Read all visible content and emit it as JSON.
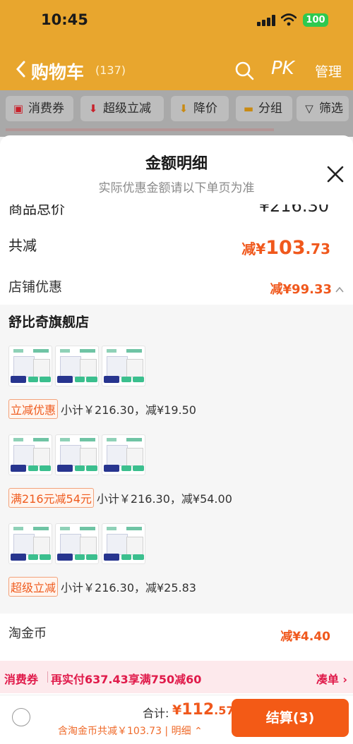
{
  "status": {
    "time": "10:45",
    "battery": "100"
  },
  "header": {
    "title": "购物车",
    "count": "(137)",
    "pk": "PK",
    "manage": "管理"
  },
  "filters": [
    {
      "label": "消费券",
      "icon": "coupon-icon"
    },
    {
      "label": "超级立减",
      "icon": "arrow-down-icon"
    },
    {
      "label": "降价",
      "icon": "price-drop-icon"
    },
    {
      "label": "分组",
      "icon": "folder-icon"
    },
    {
      "label": "筛选",
      "icon": "filter-icon"
    }
  ],
  "sheet": {
    "title": "金额明细",
    "subtitle": "实际优惠金额请以下单页为准",
    "goods_total_label": "商品总价",
    "goods_total_value": "¥216.30",
    "total_discount_label": "共减",
    "total_discount_prefix": "减¥",
    "total_discount_int": "103",
    "total_discount_cents": ".73",
    "shop_discount_label": "店铺优惠",
    "shop_discount_value": "减¥99.33",
    "shop_name": "舒比奇旗舰店",
    "groups": [
      {
        "badge": "立减优惠",
        "summary": "小计￥216.30，减¥19.50"
      },
      {
        "badge": "满216元减54元",
        "summary": "小计￥216.30，减¥54.00"
      },
      {
        "badge": "超级立减",
        "summary": "小计￥216.30，减¥25.83"
      }
    ],
    "coin_label": "淘金币",
    "coin_value": "减¥4.40"
  },
  "coupon_bar": {
    "label": "消费券",
    "message": "再实付637.43享满750减60",
    "action": "凑单 ›"
  },
  "bottom": {
    "total_label": "合计:",
    "total_prefix": "¥",
    "total_int": "112",
    "total_cents": ".57",
    "detail": "含淘金币共减￥103.73 | 明细",
    "checkout": "结算(3)"
  },
  "colors": {
    "accent": "#f35a16",
    "header": "#e8a62e",
    "coupon": "#e01a4a"
  }
}
